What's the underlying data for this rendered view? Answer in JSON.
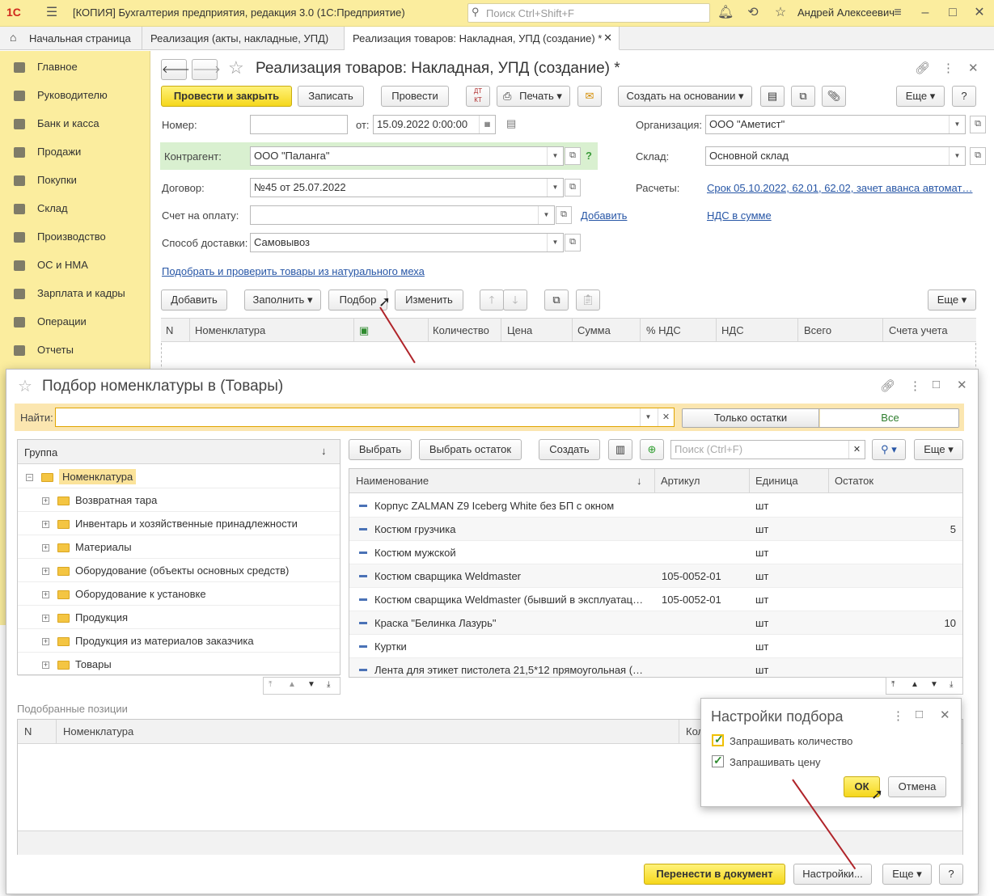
{
  "titlebar": {
    "title": "[КОПИЯ] Бухгалтерия предприятия, редакция 3.0  (1С:Предприятие)",
    "search_placeholder": "Поиск Ctrl+Shift+F",
    "user": "Андрей Алексеевич",
    "logo": "1С"
  },
  "tabs": [
    {
      "label": "Начальная страница"
    },
    {
      "label": "Реализация (акты, накладные, УПД)"
    },
    {
      "label": "Реализация товаров: Накладная, УПД (создание) *"
    }
  ],
  "sidebar": [
    "Главное",
    "Руководителю",
    "Банк и касса",
    "Продажи",
    "Покупки",
    "Склад",
    "Производство",
    "ОС и НМА",
    "Зарплата и кадры",
    "Операции",
    "Отчеты"
  ],
  "doc": {
    "title": "Реализация товаров: Накладная, УПД (создание) *",
    "buttons": {
      "post_close": "Провести и закрыть",
      "save": "Записать",
      "post": "Провести",
      "print": "Печать",
      "create_based": "Создать на основании",
      "more": "Еще",
      "help": "?"
    },
    "fields": {
      "number_label": "Номер:",
      "number": "",
      "date_label": "от:",
      "date": "15.09.2022  0:00:00",
      "org_label": "Организация:",
      "org": "ООО \"Аметист\"",
      "contractor_label": "Контрагент:",
      "contractor": "ООО \"Паланга\"",
      "warehouse_label": "Склад:",
      "warehouse": "Основной склад",
      "contract_label": "Договор:",
      "contract": "№45 от 25.07.2022",
      "settlements_label": "Расчеты:",
      "settlements": "Срок 05.10.2022, 62.01, 62.02, зачет аванса автомат…",
      "invoice_label": "Счет на оплату:",
      "invoice": "",
      "add_link": "Добавить",
      "vat_link": "НДС в сумме",
      "delivery_label": "Способ доставки:",
      "delivery": "Самовывоз",
      "fur_link": "Подобрать и проверить товары из натурального меха"
    },
    "table_buttons": {
      "add": "Добавить",
      "fill": "Заполнить",
      "select": "Подбор",
      "change": "Изменить",
      "more": "Еще"
    },
    "columns": [
      "N",
      "Номенклатура",
      "Количество",
      "Цена",
      "Сумма",
      "% НДС",
      "НДС",
      "Всего",
      "Счета учета"
    ]
  },
  "picker": {
    "title": "Подбор номенклатуры в  (Товары)",
    "find_label": "Найти:",
    "find_value": "",
    "toggle": [
      "Только остатки",
      "Все"
    ],
    "group_header": "Группа",
    "groups": [
      "Номенклатура",
      "Возвратная тара",
      "Инвентарь и хозяйственные принадлежности",
      "Материалы",
      "Оборудование (объекты основных средств)",
      "Оборудование к установке",
      "Продукция",
      "Продукция из материалов заказчика",
      "Товары"
    ],
    "buttons": {
      "select": "Выбрать",
      "select_rest": "Выбрать остаток",
      "create": "Создать",
      "search_placeholder": "Поиск (Ctrl+F)",
      "more": "Еще"
    },
    "list_columns": [
      "Наименование",
      "Артикул",
      "Единица",
      "Остаток"
    ],
    "items": [
      {
        "name": "Корпус ZALMAN Z9 Iceberg White без БП с окном",
        "article": "",
        "unit": "шт",
        "rest": ""
      },
      {
        "name": "Костюм грузчика",
        "article": "",
        "unit": "шт",
        "rest": "5"
      },
      {
        "name": "Костюм мужской",
        "article": "",
        "unit": "шт",
        "rest": ""
      },
      {
        "name": "Костюм сварщика Weldmaster",
        "article": "105-0052-01",
        "unit": "шт",
        "rest": ""
      },
      {
        "name": "Костюм сварщика Weldmaster (бывший в эксплуатац…",
        "article": "105-0052-01",
        "unit": "шт",
        "rest": ""
      },
      {
        "name": "Краска \"Белинка Лазурь\"",
        "article": "",
        "unit": "шт",
        "rest": "10"
      },
      {
        "name": "Куртки",
        "article": "",
        "unit": "шт",
        "rest": ""
      },
      {
        "name": "Лента для этикет пистолета 21,5*12 прямоугольная (…",
        "article": "",
        "unit": "шт",
        "rest": ""
      }
    ],
    "selected_label": "Подобранные позиции",
    "selected_columns": [
      "N",
      "Номенклатура",
      "Кол"
    ],
    "footer": {
      "transfer": "Перенести в документ",
      "settings": "Настройки...",
      "more": "Еще",
      "help": "?"
    }
  },
  "settings": {
    "title": "Настройки подбора",
    "ask_qty": "Запрашивать количество",
    "ask_price": "Запрашивать цену",
    "ok": "ОК",
    "cancel": "Отмена",
    "ask_qty_checked": true,
    "ask_price_checked": true
  }
}
